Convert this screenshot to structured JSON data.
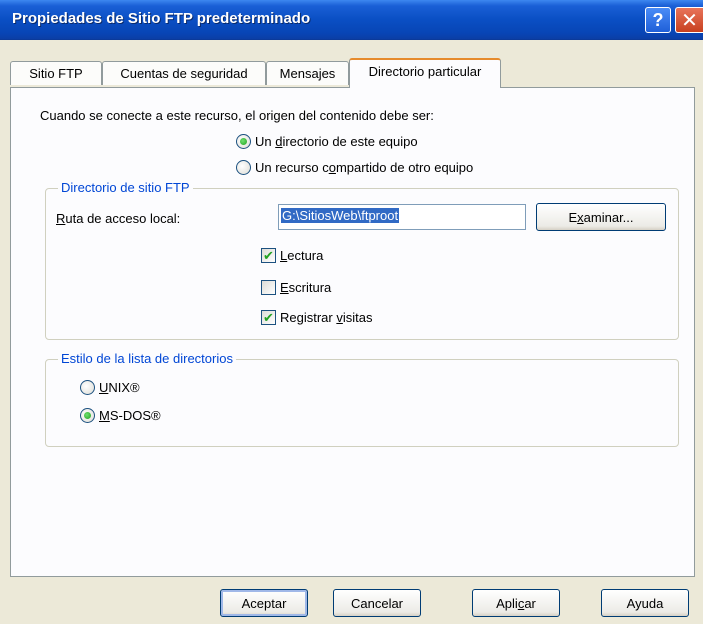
{
  "window": {
    "title": "Propiedades de Sitio FTP predeterminado",
    "help_glyph": "?",
    "close_glyph": "✕"
  },
  "tabs": [
    {
      "label": "Sitio FTP",
      "active": false
    },
    {
      "label": "Cuentas de seguridad",
      "active": false
    },
    {
      "label": "Mensajes",
      "active": false
    },
    {
      "label": "Directorio particular",
      "active": true
    }
  ],
  "source": {
    "prompt": "Cuando se conecte a este recurso, el origen del contenido debe ser:",
    "options": [
      {
        "pre": "Un ",
        "key": "d",
        "post": "irectorio de este equipo",
        "selected": true
      },
      {
        "pre": "Un recurso c",
        "key": "o",
        "post": "mpartido de otro equipo",
        "selected": false
      }
    ]
  },
  "ftp_dir": {
    "legend": "Directorio de sitio FTP",
    "path_label_key": "R",
    "path_label_rest": "uta de acceso local:",
    "path_value": "G:\\SitiosWeb\\ftproot",
    "browse_pre": "E",
    "browse_key": "x",
    "browse_post": "aminar...",
    "checks": [
      {
        "pre": "",
        "key": "L",
        "post": "ectura",
        "checked": true
      },
      {
        "pre": "",
        "key": "E",
        "post": "scritura",
        "checked": false
      },
      {
        "pre": "Registrar ",
        "key": "v",
        "post": "isitas",
        "checked": true
      }
    ]
  },
  "dir_style": {
    "legend": "Estilo de la lista de directorios",
    "options": [
      {
        "key": "U",
        "post": "NIX®",
        "selected": false
      },
      {
        "key": "M",
        "post": "S-DOS®",
        "selected": true
      }
    ]
  },
  "buttons": {
    "ok": "Aceptar",
    "cancel": "Cancelar",
    "apply_pre": "Apli",
    "apply_key": "c",
    "apply_post": "ar",
    "help": "Ayuda"
  },
  "colors": {
    "titlebar": "#0a4fc4",
    "active_tab_accent": "#e68b2c",
    "group_legend": "#0046d5",
    "selection": "#316ac5",
    "check_green": "#21a121"
  }
}
